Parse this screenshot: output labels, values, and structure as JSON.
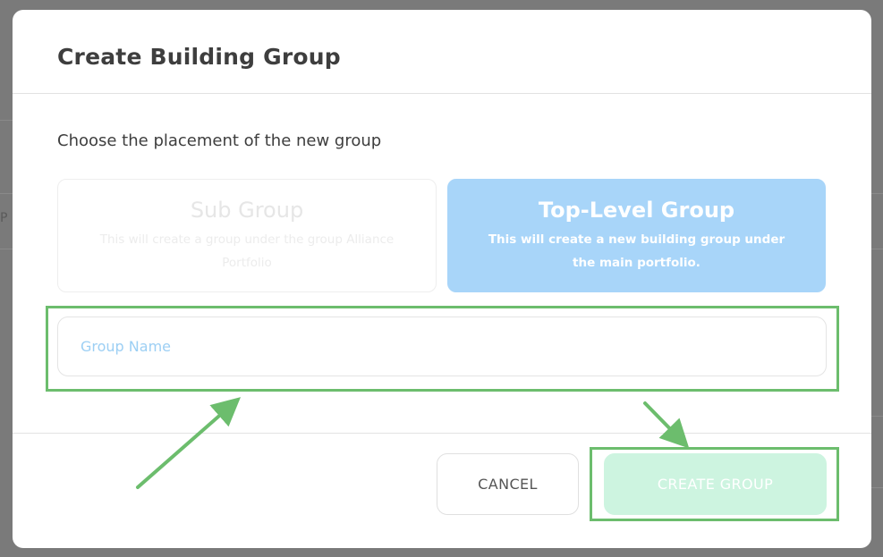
{
  "modal": {
    "title": "Create Building Group",
    "prompt": "Choose the placement of the new group"
  },
  "options": {
    "sub_group": {
      "title": "Sub Group",
      "description": "This will create a group under the group Alliance Portfolio",
      "selected": false
    },
    "top_level_group": {
      "title": "Top-Level Group",
      "description": "This will create a new building group under the main portfolio.",
      "selected": true
    }
  },
  "group_name_input": {
    "placeholder": "Group Name",
    "value": ""
  },
  "buttons": {
    "cancel": "CANCEL",
    "create": "CREATE GROUP"
  },
  "colors": {
    "selected_option": "#a8d5f9",
    "create_button": "#cdf4e0",
    "annotation": "#6cbd6d"
  }
}
